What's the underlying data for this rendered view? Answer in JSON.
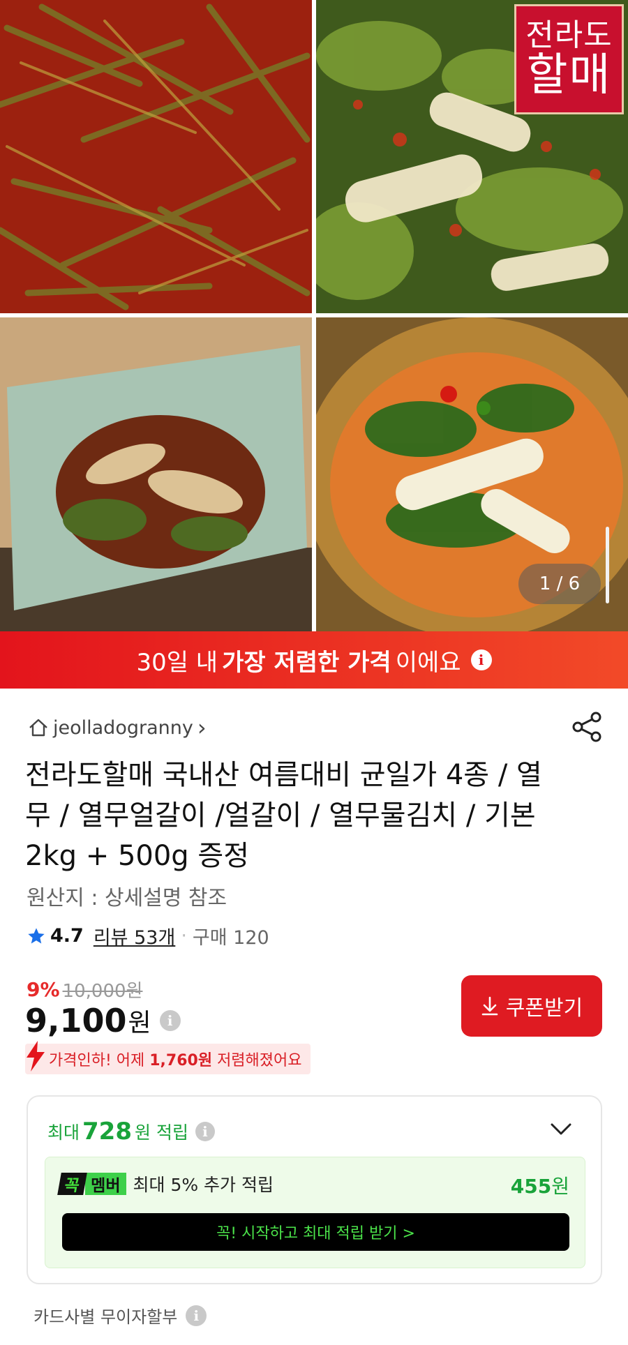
{
  "gallery": {
    "logo_line1": "전라도",
    "logo_line2": "할매",
    "page_counter": "1 / 6"
  },
  "banner": {
    "prefix": "30일 내 ",
    "bold": "가장 저렴한 가격",
    "suffix": "이에요",
    "info_icon": "info-icon"
  },
  "seller": {
    "name": "jeolladogranny",
    "arrow": "›"
  },
  "product": {
    "title": "전라도할매 국내산 여름대비 균일가 4종 / 열무 / 열무얼갈이 /얼갈이 / 열무물김치 / 기본 2kg + 500g 증정",
    "origin": "원산지 : 상세설명 참조"
  },
  "rating": {
    "score": "4.7",
    "reviews": "리뷰 53개",
    "separator": "·",
    "purchases": "구매 120"
  },
  "pricing": {
    "discount": "9%",
    "original_price": "10,000원",
    "price": "9,100",
    "price_unit": "원",
    "coupon_button": "쿠폰받기",
    "drop_prefix": "가격인하! 어제 ",
    "drop_amount": "1,760원",
    "drop_suffix": " 저렴해졌어요"
  },
  "points": {
    "prefix": "최대 ",
    "amount": "728",
    "suffix": "원 적립",
    "member_badge_1": "꼭",
    "member_badge_2": "멤버",
    "member_text": "최대 5% 추가 적립",
    "member_amount": "455",
    "member_unit": "원",
    "start_button": "꼭! 시작하고 최대 적립 받기  >"
  },
  "installment": {
    "label": "카드사별 무이자할부"
  },
  "colors": {
    "brand_red": "#df1b22",
    "point_green": "#19a33a",
    "member_green": "#3ed04a"
  }
}
